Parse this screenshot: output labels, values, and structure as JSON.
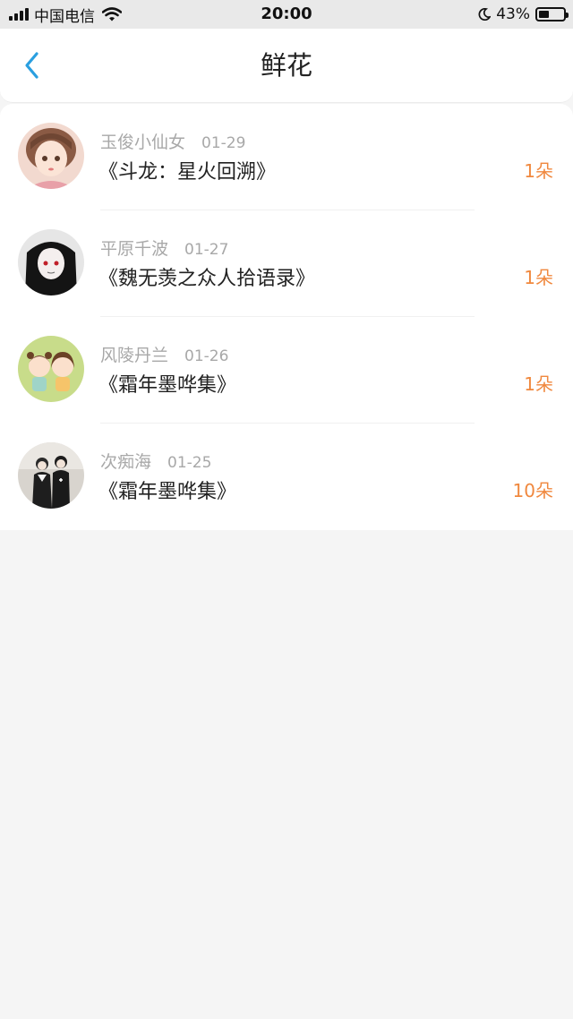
{
  "status_bar": {
    "carrier": "中国电信",
    "time": "20:00",
    "battery": "43%",
    "battery_level": 0.43
  },
  "header": {
    "title": "鲜花"
  },
  "items": [
    {
      "user": "玉俊小仙女",
      "date": "01-29",
      "book": "《斗龙：星火回溯》",
      "count": "1朵"
    },
    {
      "user": "平原千波",
      "date": "01-27",
      "book": "《魏无羡之众人拾语录》",
      "count": "1朵"
    },
    {
      "user": "风陵丹兰",
      "date": "01-26",
      "book": "《霜年墨哗集》",
      "count": "1朵"
    },
    {
      "user": "次痴海",
      "date": "01-25",
      "book": "《霜年墨哗集》",
      "count": "10朵"
    }
  ],
  "colors": {
    "accent": "#2a9fe0",
    "count": "#f0883e",
    "status_bar_bg": "#e9e9e9"
  }
}
